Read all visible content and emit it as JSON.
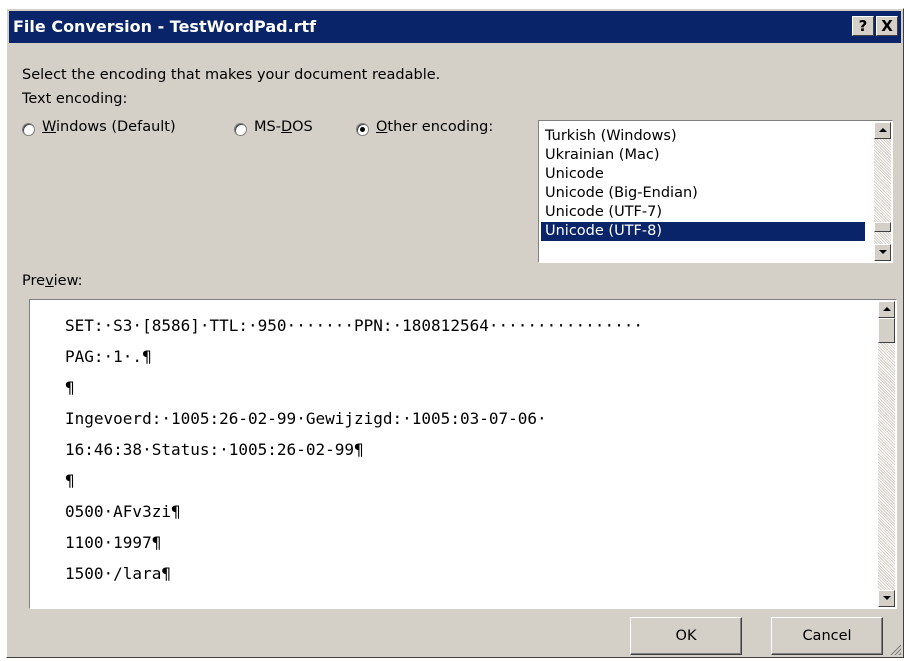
{
  "window": {
    "title": "File Conversion - TestWordPad.rtf",
    "help_label": "?",
    "close_label": "X"
  },
  "instructions": "Select the encoding that makes your document readable.",
  "text_encoding_label": "Text encoding:",
  "radios": {
    "windows": {
      "pre": "",
      "accel": "W",
      "post": "indows (Default)",
      "checked": false
    },
    "msdos": {
      "pre": "MS-",
      "accel": "D",
      "post": "OS",
      "checked": false
    },
    "other": {
      "pre": "",
      "accel": "O",
      "post": "ther encoding:",
      "checked": true
    }
  },
  "encoding_list": {
    "items": [
      "Turkish (Windows)",
      "Ukrainian (Mac)",
      "Unicode",
      "Unicode (Big-Endian)",
      "Unicode (UTF-7)",
      "Unicode (UTF-8)"
    ],
    "selected": "Unicode (UTF-8)"
  },
  "preview": {
    "label_pre": "Pre",
    "label_accel": "v",
    "label_post": "iew:",
    "lines": [
      "SET:·S3·[8586]·TTL:·950·······PPN:·180812564················",
      "PAG:·1·.¶",
      "¶",
      "Ingevoerd:·1005:26-02-99·Gewijzigd:·1005:03-07-06·",
      "16:46:38·Status:·1005:26-02-99¶",
      "¶",
      "0500·AFv3zi¶",
      "1100·1997¶",
      "1500·/lara¶"
    ]
  },
  "buttons": {
    "ok": "OK",
    "cancel": "Cancel"
  },
  "colors": {
    "titlebar": "#0a246a",
    "face": "#d4d0c8",
    "selection": "#0a246a"
  }
}
